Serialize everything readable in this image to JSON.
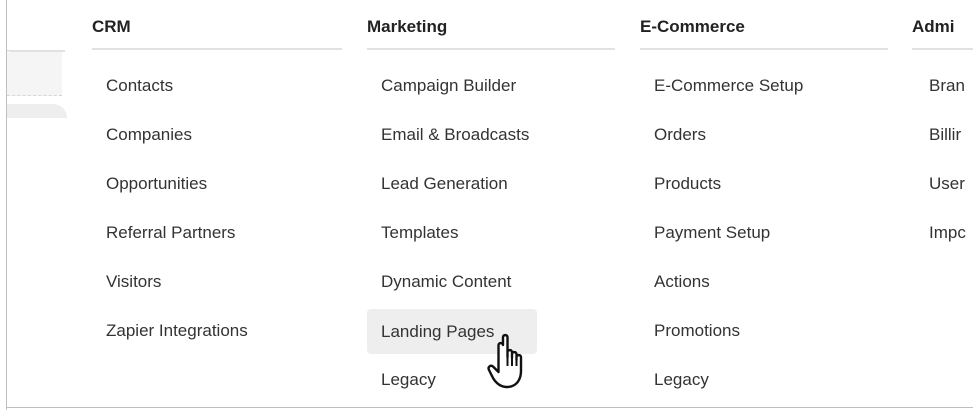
{
  "menu": {
    "columns": [
      {
        "heading": "CRM",
        "items": [
          "Contacts",
          "Companies",
          "Opportunities",
          "Referral Partners",
          "Visitors",
          "Zapier Integrations"
        ]
      },
      {
        "heading": "Marketing",
        "items": [
          "Campaign Builder",
          "Email & Broadcasts",
          "Lead Generation",
          "Templates",
          "Dynamic Content",
          "Landing Pages",
          "Legacy"
        ],
        "hovered_item": "Landing Pages"
      },
      {
        "heading": "E-Commerce",
        "items": [
          "E-Commerce Setup",
          "Orders",
          "Products",
          "Payment Setup",
          "Actions",
          "Promotions",
          "Legacy"
        ]
      },
      {
        "heading": "Admi",
        "items": [
          "Bran",
          "Billir",
          "User",
          "Impc"
        ]
      }
    ]
  },
  "cursor": {
    "icon": "hand-pointer-icon"
  },
  "colors": {
    "hover_bg": "#eeeeee",
    "heading_text": "#222222",
    "item_text": "#333333",
    "divider": "#e1e1e1"
  }
}
